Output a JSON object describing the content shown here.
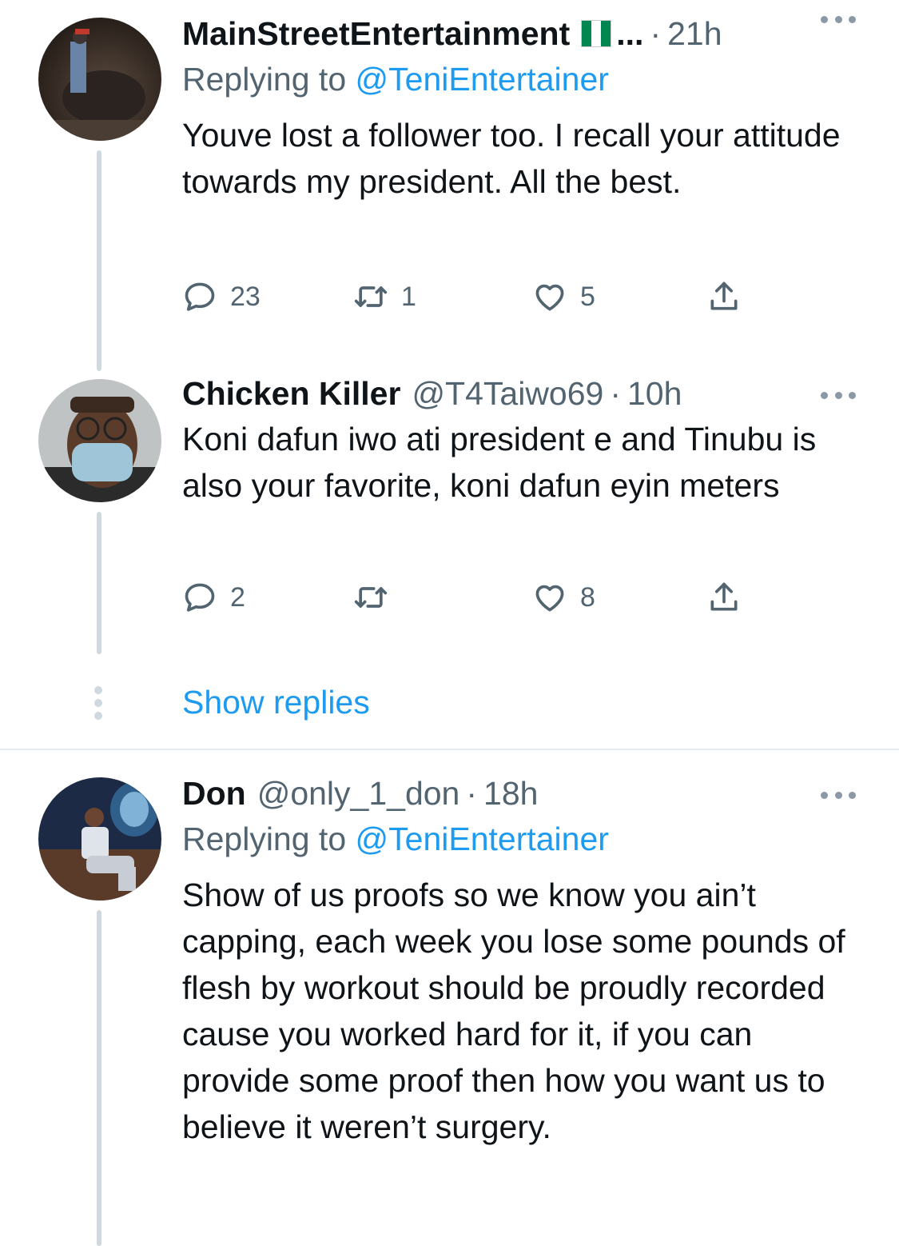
{
  "tweets": [
    {
      "name": "MainStreetEntertainment",
      "name_suffix": "...",
      "time": "21h",
      "replying_prefix": "Replying to",
      "replying_to": "@TeniEntertainer",
      "text": "Youve lost a follower too. I recall your attitude towards my president. All the best.",
      "replies": "23",
      "retweets": "1",
      "likes": "5"
    },
    {
      "name": "Chicken Killer",
      "handle": "@T4Taiwo69",
      "time": "10h",
      "text": "Koni dafun iwo ati president e and Tinubu is also your favorite, koni dafun eyin meters",
      "replies": "2",
      "retweets": "",
      "likes": "8"
    },
    {
      "name": "Don",
      "handle": "@only_1_don",
      "time": "18h",
      "replying_prefix": "Replying to",
      "replying_to": "@TeniEntertainer",
      "text": "Show of us proofs so we know you ain’t capping, each week you lose some pounds of flesh by workout should be proudly recorded cause you worked hard for it, if you can provide some proof then how you want us to believe it weren’t surgery."
    }
  ],
  "show_replies": "Show replies",
  "separator": "·",
  "colors": {
    "accent": "#1d9bf0",
    "secondary_text": "#536471",
    "thread_line": "#cfd9de",
    "nigeria_green": "#008751"
  },
  "icons": [
    "reply-icon",
    "retweet-icon",
    "like-icon",
    "share-icon",
    "more-icon",
    "nigeria-flag-icon"
  ]
}
